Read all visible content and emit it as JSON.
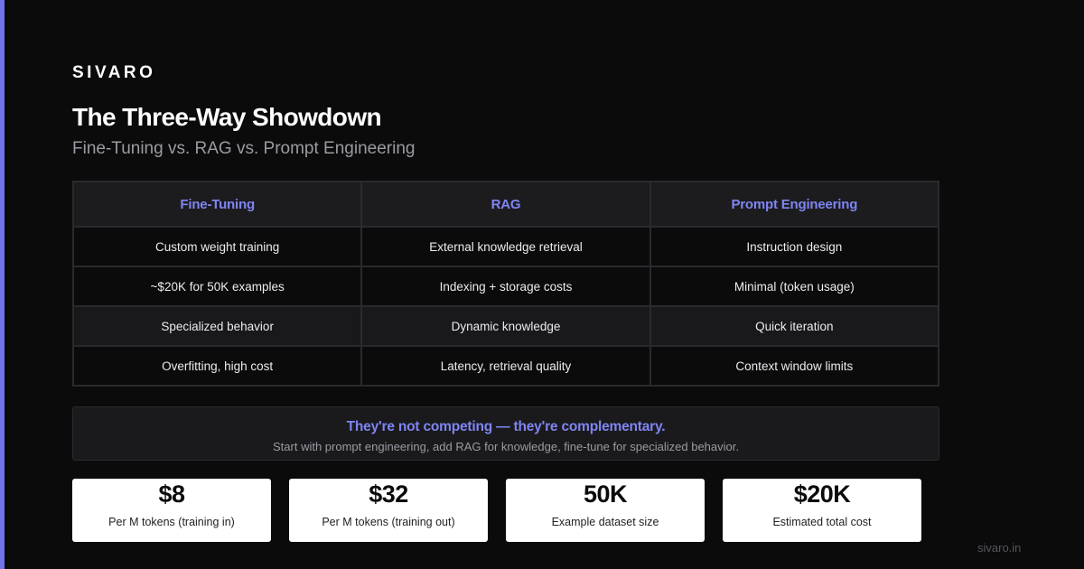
{
  "brand": "SIVARO",
  "title": "The Three-Way Showdown",
  "subtitle": "Fine-Tuning vs. RAG vs. Prompt Engineering",
  "table": {
    "headers": [
      "Fine-Tuning",
      "RAG",
      "Prompt Engineering"
    ],
    "rows": [
      [
        "Custom weight training",
        "External knowledge retrieval",
        "Instruction design"
      ],
      [
        "~$20K for 50K examples",
        "Indexing + storage costs",
        "Minimal (token usage)"
      ],
      [
        "Specialized behavior",
        "Dynamic knowledge",
        "Quick iteration"
      ],
      [
        "Overfitting, high cost",
        "Latency, retrieval quality",
        "Context window limits"
      ]
    ]
  },
  "callout": {
    "headline": "They're not competing — they're complementary.",
    "body": "Start with prompt engineering, add RAG for knowledge, fine-tune for specialized behavior."
  },
  "stats": [
    {
      "value": "$8",
      "label": "Per M tokens (training in)"
    },
    {
      "value": "$32",
      "label": "Per M tokens (training out)"
    },
    {
      "value": "50K",
      "label": "Example dataset size"
    },
    {
      "value": "$20K",
      "label": "Estimated total cost"
    }
  ],
  "footer": "sivaro.in",
  "colors": {
    "background": "#0b0b0c",
    "accent": "#6f74e8",
    "accent_text": "#7f85f2",
    "card": "#ffffff"
  }
}
